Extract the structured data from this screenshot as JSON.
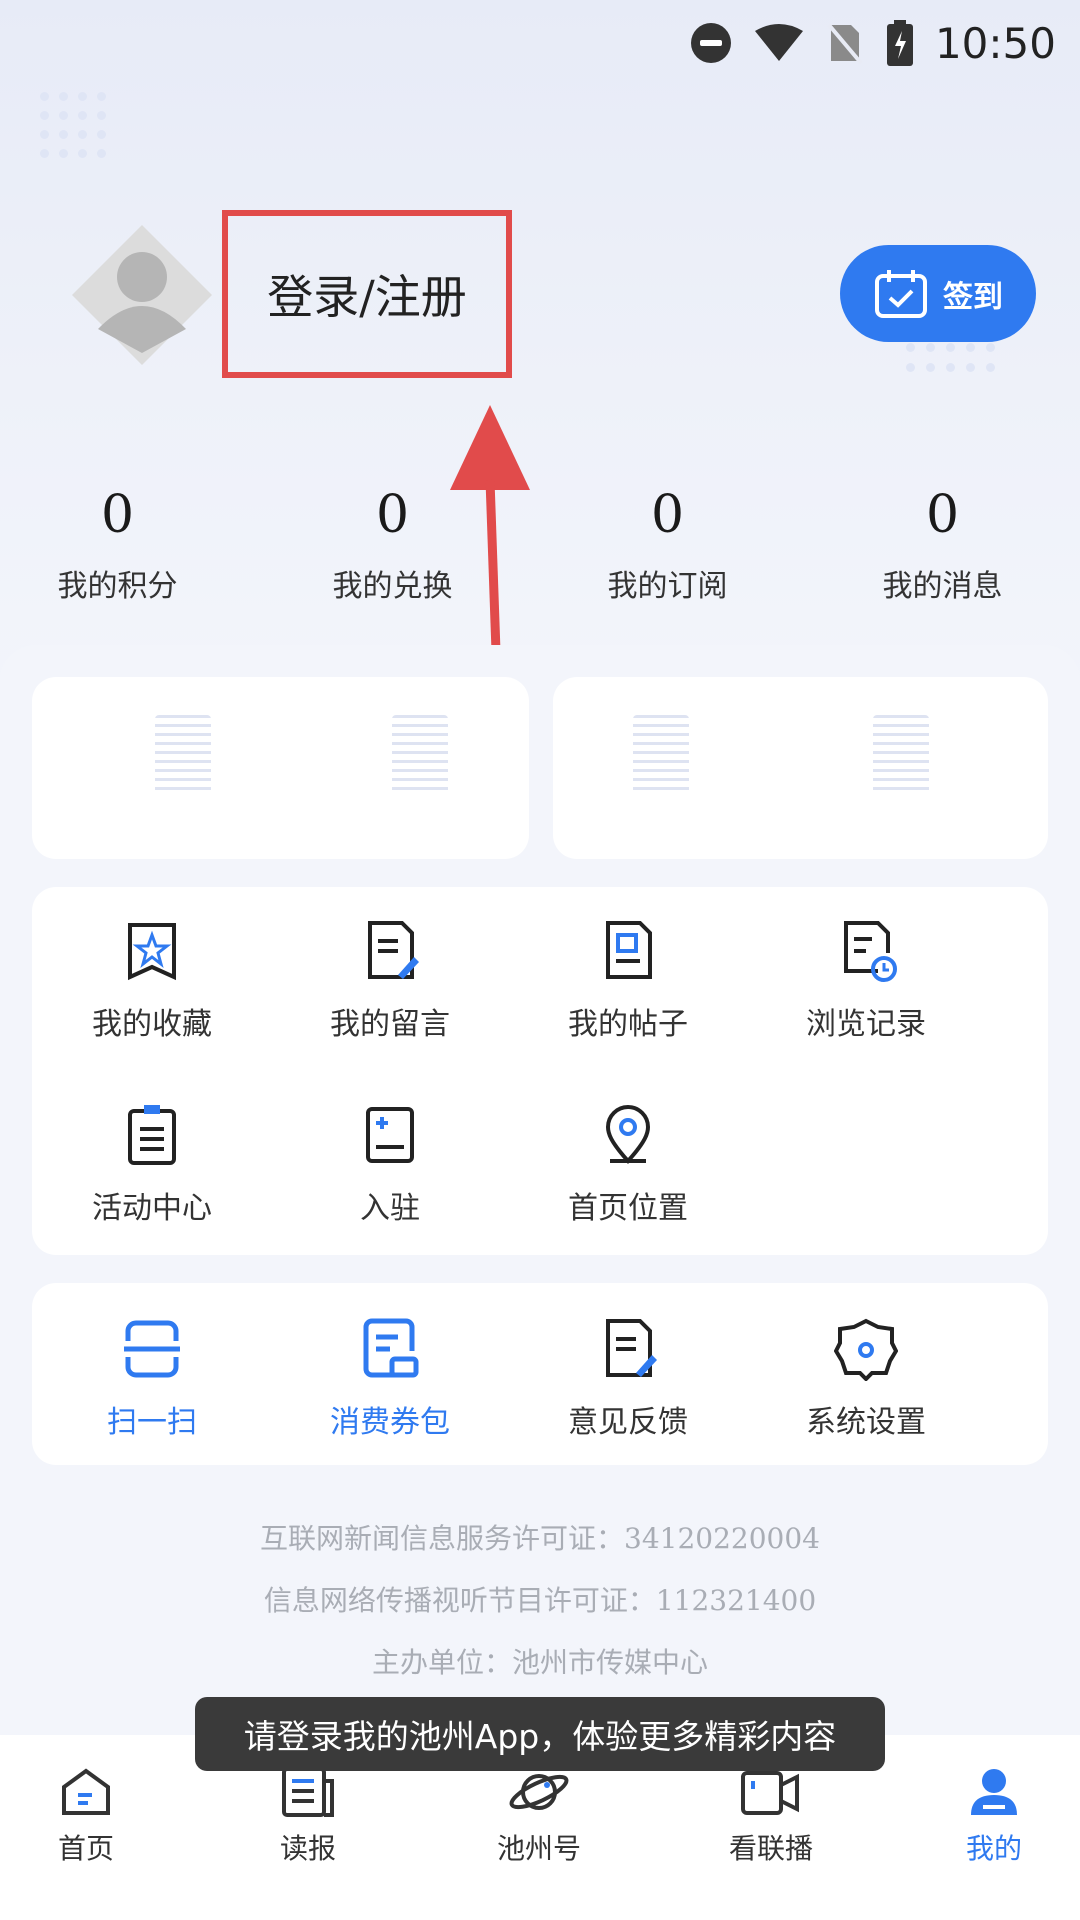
{
  "status_bar": {
    "time": "10:50"
  },
  "profile": {
    "login_label": "登录/注册",
    "signin_label": "签到"
  },
  "stats": [
    {
      "value": "0",
      "label": "我的积分"
    },
    {
      "value": "0",
      "label": "我的兑换"
    },
    {
      "value": "0",
      "label": "我的订阅"
    },
    {
      "value": "0",
      "label": "我的消息"
    }
  ],
  "menu": [
    {
      "label": "我的收藏",
      "icon": "star-bookmark-icon"
    },
    {
      "label": "我的留言",
      "icon": "message-edit-icon"
    },
    {
      "label": "我的帖子",
      "icon": "post-document-icon"
    },
    {
      "label": "浏览记录",
      "icon": "history-clock-icon"
    },
    {
      "label": "活动中心",
      "icon": "clipboard-list-icon"
    },
    {
      "label": "入驻",
      "icon": "join-plus-icon"
    },
    {
      "label": "首页位置",
      "icon": "location-pin-icon"
    }
  ],
  "tools": [
    {
      "label": "扫一扫",
      "icon": "scan-icon"
    },
    {
      "label": "消费券包",
      "icon": "coupon-icon"
    },
    {
      "label": "意见反馈",
      "icon": "feedback-edit-icon"
    },
    {
      "label": "系统设置",
      "icon": "settings-gear-icon"
    }
  ],
  "footer": {
    "license1": "互联网新闻信息服务许可证：34120220004",
    "license2": "信息网络传播视听节目许可证：112321400",
    "sponsor": "主办单位：池州市传媒中心"
  },
  "toast": "请登录我的池州App，体验更多精彩内容",
  "tabs": [
    {
      "label": "首页",
      "icon": "home-icon"
    },
    {
      "label": "读报",
      "icon": "newspaper-icon"
    },
    {
      "label": "池州号",
      "icon": "planet-icon"
    },
    {
      "label": "看联播",
      "icon": "video-icon"
    },
    {
      "label": "我的",
      "icon": "user-icon"
    }
  ],
  "colors": {
    "accent": "#2f7af0",
    "highlight": "#e14b4b"
  }
}
